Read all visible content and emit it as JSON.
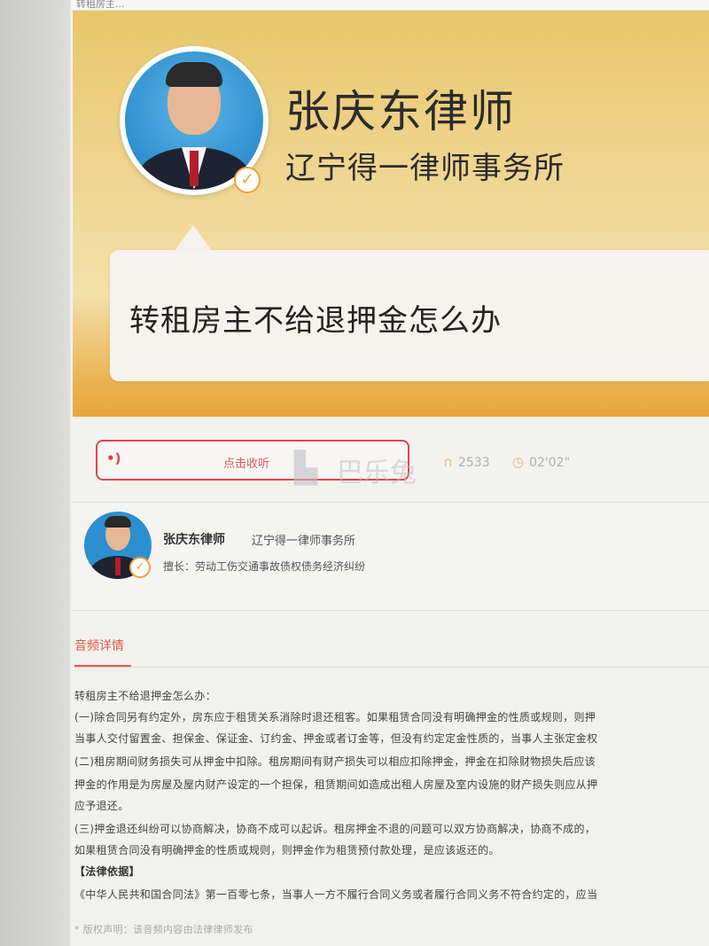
{
  "top_bar": {
    "text": "转租房主..."
  },
  "hero": {
    "lawyer_name": "张庆东律师",
    "firm_name": "辽宁得一律师事务所",
    "question": "转租房主不给退押金怎么办"
  },
  "audio": {
    "play_label": "点击收听",
    "watermark": "巴乐兔",
    "listens": "2533",
    "duration": "02'02\""
  },
  "lawyer_card": {
    "name": "张庆东律师",
    "firm": "辽宁得一律师事务所",
    "specialty": "擅长：劳动工伤交通事故债权债务经济纠纷"
  },
  "details": {
    "title": "音频详情",
    "paragraphs": [
      "转租房主不给退押金怎么办：",
      "(一)除合同另有约定外，房东应于租赁关系消除时退还租客。如果租赁合同没有明确押金的性质或规则，则押",
      "当事人交付留置金、担保金、保证金、订约金、押金或者订金等，但没有约定定金性质的，当事人主张定金权",
      "(二)租房期间财务损失可从押金中扣除。租房期间有财产损失可以相应扣除押金，押金在扣除财物损失后应该",
      "押金的作用是为房屋及屋内财产设定的一个担保，租赁期间如造成出租人房屋及室内设施的财产损失则应从押",
      "应予退还。",
      "(三)押金退还纠纷可以协商解决，协商不成可以起诉。租房押金不退的问题可以双方协商解决，协商不成的，",
      "如果租赁合同没有明确押金的性质或规则，则押金作为租赁预付款处理，是应该返还的。",
      "【法律依据】",
      "《中华人民共和国合同法》第一百零七条，当事人一方不履行合同义务或者履行合同义务不符合约定的，应当",
      "* 版权声明：该音频内容由法律律师发布"
    ]
  },
  "colors": {
    "accent_red": "#e0454a",
    "hero_gold": "#e8c76a",
    "verified_orange": "#f0a23a",
    "stat_orange": "#f2b37a"
  }
}
